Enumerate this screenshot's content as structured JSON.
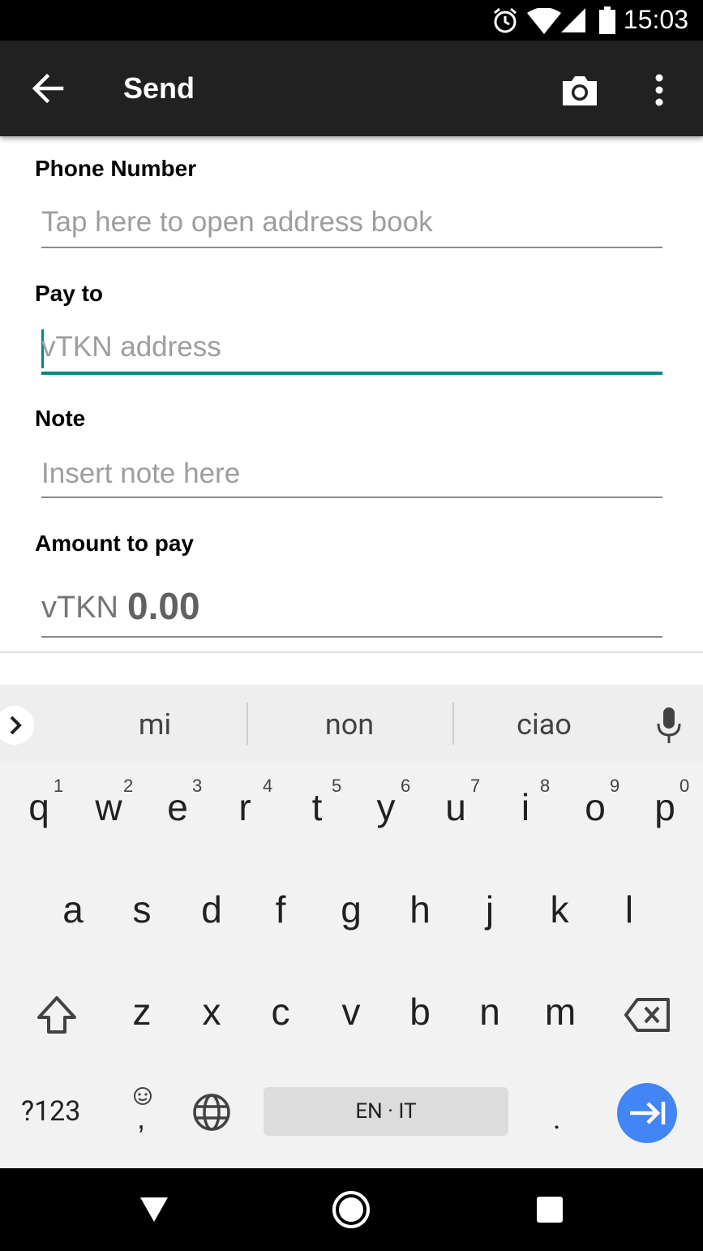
{
  "status_bar": {
    "time": "15:03"
  },
  "toolbar": {
    "title": "Send"
  },
  "form": {
    "phone": {
      "label": "Phone Number",
      "placeholder": "Tap here to open address book"
    },
    "pay_to": {
      "label": "Pay to",
      "placeholder": "vTKN address"
    },
    "note": {
      "label": "Note",
      "placeholder": "Insert note here"
    },
    "amount": {
      "label": "Amount to pay",
      "currency": "vTKN",
      "value": "0.00"
    }
  },
  "keyboard": {
    "suggestions": [
      "mi",
      "non",
      "ciao"
    ],
    "row1": [
      {
        "ch": "q",
        "num": "1"
      },
      {
        "ch": "w",
        "num": "2"
      },
      {
        "ch": "e",
        "num": "3"
      },
      {
        "ch": "r",
        "num": "4"
      },
      {
        "ch": "t",
        "num": "5"
      },
      {
        "ch": "y",
        "num": "6"
      },
      {
        "ch": "u",
        "num": "7"
      },
      {
        "ch": "i",
        "num": "8"
      },
      {
        "ch": "o",
        "num": "9"
      },
      {
        "ch": "p",
        "num": "0"
      }
    ],
    "row2": [
      "a",
      "s",
      "d",
      "f",
      "g",
      "h",
      "j",
      "k",
      "l"
    ],
    "row3": [
      "z",
      "x",
      "c",
      "v",
      "b",
      "n",
      "m"
    ],
    "symbols_label": "?123",
    "comma": ",",
    "space_label": "EN · IT",
    "period": "."
  },
  "colors": {
    "accent": "#00897b",
    "toolbar": "#212121",
    "enter_key": "#4285f4"
  }
}
